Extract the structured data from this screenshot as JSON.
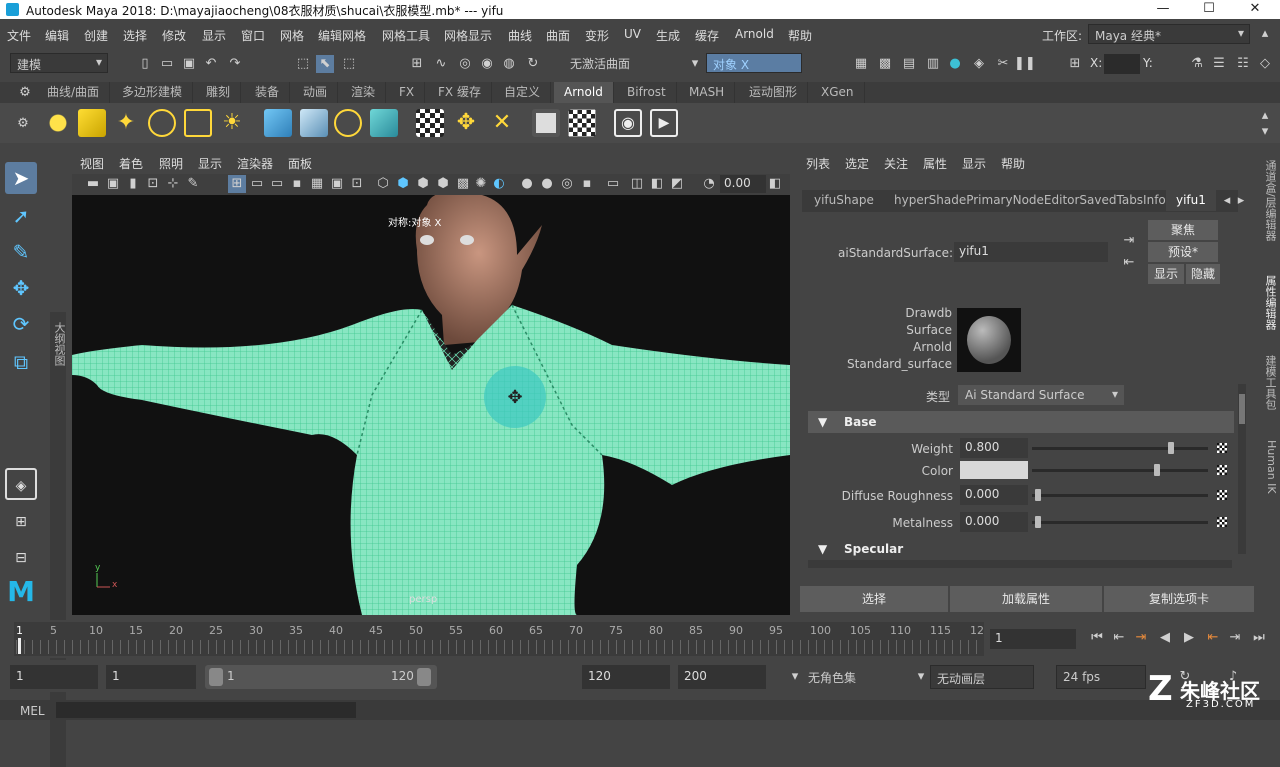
{
  "window": {
    "title": "Autodesk Maya 2018: D:\\mayajiaocheng\\08衣服材质\\shucai\\衣服模型.mb*   ---   yifu",
    "minimize": "—",
    "maximize": "☐",
    "close": "✕"
  },
  "menubar": {
    "items": [
      "文件",
      "编辑",
      "创建",
      "选择",
      "修改",
      "显示",
      "窗口",
      "网格",
      "编辑网格",
      "网格工具",
      "网格显示",
      "曲线",
      "曲面",
      "变形",
      "UV",
      "生成",
      "缓存",
      "Arnold",
      "帮助"
    ],
    "workspace_label": "工作区:",
    "workspace_value": "Maya 经典*"
  },
  "statusbar": {
    "mode": "建模",
    "live_surface": "无激活曲面",
    "object_field": "对象 X",
    "x_label": "X:",
    "y_label": "Y:"
  },
  "shelf": {
    "tabs": [
      "曲线/曲面",
      "多边形建模",
      "雕刻",
      "装备",
      "动画",
      "渲染",
      "FX",
      "FX 缓存",
      "自定义",
      "Arnold",
      "Bifrost",
      "MASH",
      "运动图形",
      "XGen"
    ],
    "active_tab": "Arnold"
  },
  "toolbox": {
    "side_label": "大纲视图"
  },
  "viewport": {
    "menu": [
      "视图",
      "着色",
      "照明",
      "显示",
      "渲染器",
      "面板"
    ],
    "numeric_field": "0.00",
    "hud_label": "对称:对象 X",
    "camera_label": "persp",
    "axis_y": "y",
    "axis_x": "x"
  },
  "attribute_editor": {
    "menu": [
      "列表",
      "选定",
      "关注",
      "属性",
      "显示",
      "帮助"
    ],
    "tabs": [
      "yifuShape",
      "hyperShadePrimaryNodeEditorSavedTabsInfo",
      "yifu1"
    ],
    "active_tab": "yifu1",
    "node_type_label": "aiStandardSurface:",
    "node_name": "yifu1",
    "focus_button": "聚焦",
    "presets_button": "预设*",
    "show_button": "显示",
    "hide_button": "隐藏",
    "swatch_info": [
      "Drawdb",
      "Surface",
      "Arnold",
      "Standard_surface"
    ],
    "type_label": "类型",
    "type_value": "Ai Standard Surface",
    "section_base": "Base",
    "attrs": [
      {
        "label": "Weight",
        "value": "0.800",
        "slider": 0.8
      },
      {
        "label": "Color",
        "value": "",
        "slider": 0.75
      },
      {
        "label": "Diffuse Roughness",
        "value": "0.000",
        "slider": 0.0
      },
      {
        "label": "Metalness",
        "value": "0.000",
        "slider": 0.0
      }
    ],
    "color_value": "#d8d8d8",
    "section_specular": "Specular",
    "buttons": [
      "选择",
      "加载属性",
      "复制选项卡"
    ]
  },
  "right_tabs": [
    "通道盒/层编辑器",
    "属性编辑器",
    "建模工具包",
    "Human IK"
  ],
  "timeline": {
    "ticks": [
      "1",
      "5",
      "10",
      "15",
      "20",
      "25",
      "30",
      "35",
      "40",
      "45",
      "50",
      "55",
      "60",
      "65",
      "70",
      "75",
      "80",
      "85",
      "90",
      "95",
      "100",
      "105",
      "110",
      "115",
      "12"
    ],
    "current_frame": "1"
  },
  "range": {
    "start": "1",
    "playback_start": "1",
    "slider_start": "1",
    "slider_end": "120",
    "playback_end": "120",
    "end": "200",
    "char_set": "无角色集",
    "anim_layer": "无动画层",
    "fps": "24 fps"
  },
  "command_line": {
    "label": "MEL"
  },
  "watermark": {
    "text": "朱峰社区",
    "sub": "ZF3D.COM"
  }
}
